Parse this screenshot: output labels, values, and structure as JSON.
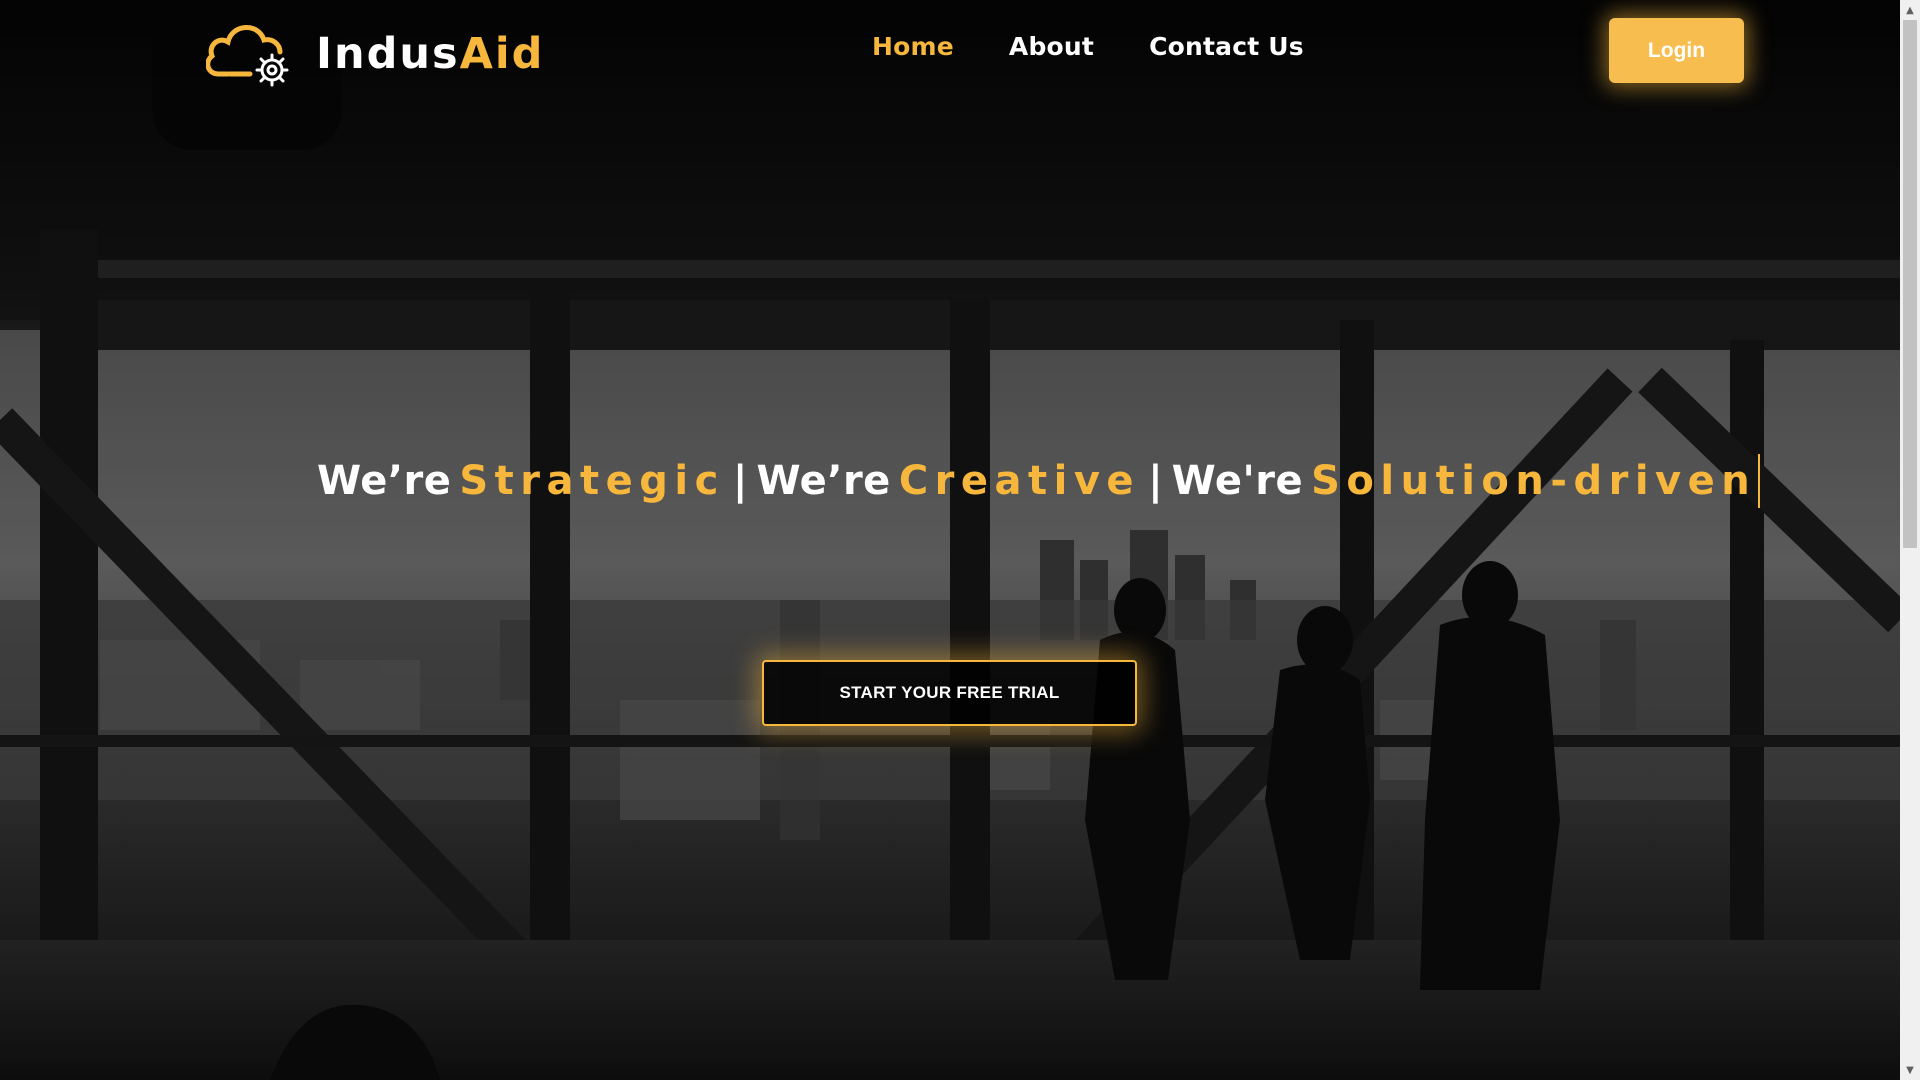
{
  "header": {
    "brand_part1": "Indus",
    "brand_part2": "Aid",
    "logo_icon": "cloud-gear-icon",
    "nav": [
      {
        "label": "Home",
        "active": true
      },
      {
        "label": "About",
        "active": false
      },
      {
        "label": "Contact Us",
        "active": false
      }
    ],
    "login_label": "Login"
  },
  "hero": {
    "headline": [
      {
        "lead": "We’re",
        "accent": "Strategic"
      },
      {
        "lead": "We’re",
        "accent": "Creative"
      },
      {
        "lead": "We're",
        "accent": "Solution-driven"
      }
    ],
    "separator": "|",
    "cta_label": "START YOUR FREE TRIAL",
    "background": "office-skyline-photo"
  },
  "theme": {
    "accent": "#f6b73c",
    "login_bg": "#f7be4f",
    "text": "#ffffff",
    "dark": "#0a0a0a"
  }
}
